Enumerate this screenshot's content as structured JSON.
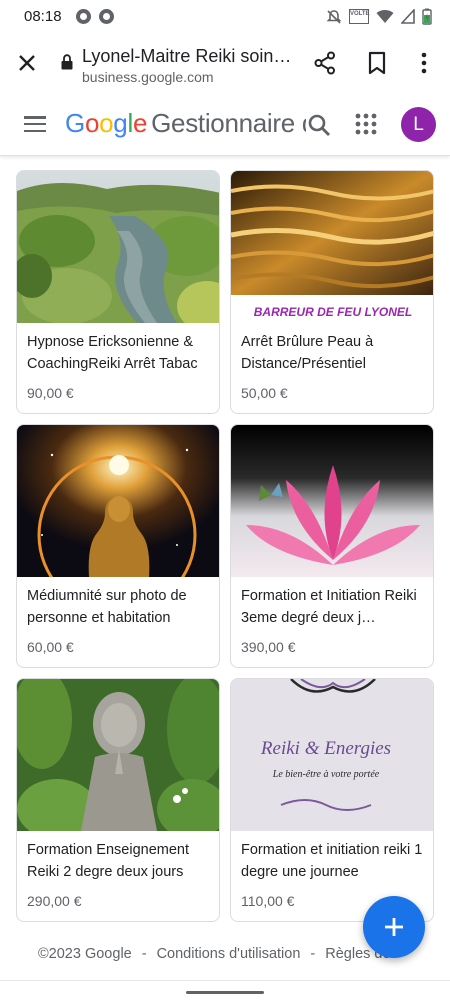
{
  "status_bar": {
    "time": "08:18",
    "left_icons": [
      "chrome-notification-icon",
      "chrome-notification-icon"
    ],
    "right_icons": [
      "mute-icon",
      "volte-icon",
      "wifi-icon",
      "signal-icon",
      "battery-charging-icon"
    ],
    "volte_label": "VOLTE"
  },
  "url_bar": {
    "title": "Lyonel-Maitre Reiki soins...",
    "domain": "business.google.com"
  },
  "header": {
    "brand_letters": [
      "G",
      "o",
      "o",
      "g",
      "l",
      "e"
    ],
    "product": "Gestionnaire d",
    "avatar_letter": "L"
  },
  "cards": [
    {
      "title": "Hypnose Ericksonienne & CoachingReiki Arrêt Tabac",
      "price": "90,00 €",
      "image": "river-garden-photo"
    },
    {
      "title": "Arrêt Brûlure Peau à Distance/Présentiel",
      "price": "50,00 €",
      "image": "fire-water-photo",
      "image_caption": "BARREUR DE FEU LYONEL"
    },
    {
      "title": "Médiumnité sur photo de personne et habitation",
      "price": "60,00 €",
      "image": "golden-buddha-photo"
    },
    {
      "title": "Formation et Initiation Reiki 3eme degré deux j…",
      "price": "390,00 €",
      "image": "lotus-flower-photo"
    },
    {
      "title": "Formation Enseignement Reiki 2 degre deux jours",
      "price": "290,00 €",
      "image": "stone-buddha-photo"
    },
    {
      "title": "Formation et initiation reiki 1 degre une journee",
      "price": "110,00 €",
      "image": "reiki-energies-card-photo",
      "image_text_1": "Reiki & Energies",
      "image_text_2": "Le bien-être à votre portée"
    }
  ],
  "footer": {
    "copyright": "©2023 Google",
    "separator": "-",
    "terms": "Conditions d'utilisation",
    "rules": "Règles de"
  },
  "fab": {
    "icon": "plus-icon"
  },
  "colors": {
    "accent_blue": "#1a73e8",
    "avatar_purple": "#8e24aa",
    "google_blue": "#4285f4",
    "google_red": "#ea4335",
    "google_yellow": "#fbbc05",
    "google_green": "#34a853"
  }
}
